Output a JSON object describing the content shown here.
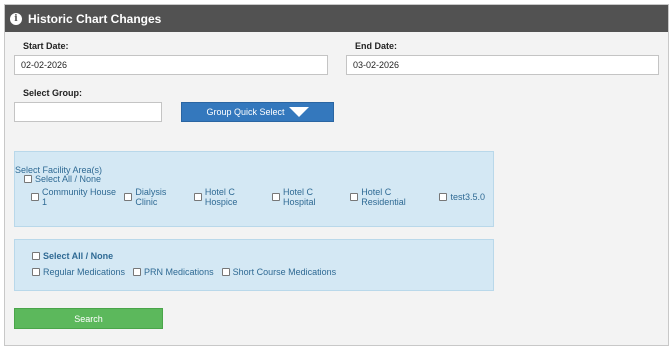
{
  "panel": {
    "title": "Historic Chart Changes",
    "icon": "info-icon"
  },
  "dates": {
    "start_label": "Start Date:",
    "start_value": "02-02-2026",
    "end_label": "End Date:",
    "end_value": "03-02-2026"
  },
  "group": {
    "label": "Select Group:",
    "value": "",
    "quick_select_label": "Group Quick Select"
  },
  "facility": {
    "title": "Select Facility Area(s)",
    "select_all_label": "Select All / None",
    "items": [
      "Community House 1",
      "Dialysis Clinic",
      "Hotel C Hospice",
      "Hotel C Hospital",
      "Hotel C Residential",
      "test3.5.0"
    ]
  },
  "medications": {
    "select_all_label": "Select All / None",
    "items": [
      "Regular Medications",
      "PRN Medications",
      "Short Course Medications"
    ]
  },
  "search_label": "Search",
  "colors": {
    "header": "#525252",
    "quick_select": "#3478bd",
    "search": "#5cb85c",
    "box": "#d4e8f4"
  }
}
